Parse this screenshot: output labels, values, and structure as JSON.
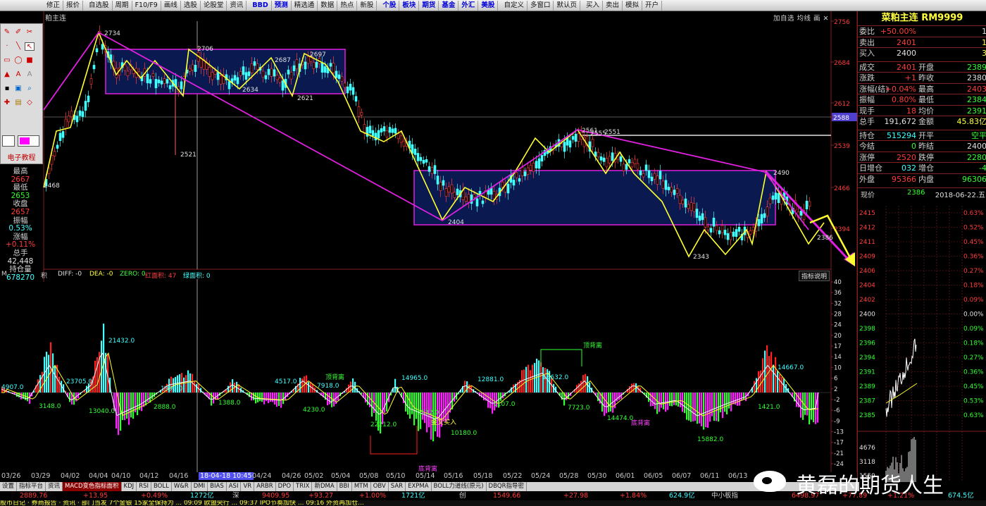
{
  "toolbar": {
    "items": [
      "修正",
      "报价",
      "自选股",
      "周期",
      "F10/F9",
      "画线",
      "选股",
      "论股堂",
      "资讯",
      "BBD",
      "预测",
      "精选通",
      "数据",
      "热点",
      "新股",
      "个股",
      "板块",
      "期货",
      "基金",
      "外汇",
      "美股",
      "自定义",
      "多窗口",
      "默认页",
      "买入",
      "卖出",
      "模拟",
      "开户"
    ],
    "blue_items": [
      "BBD",
      "预测",
      "个股",
      "板块",
      "期货",
      "基金",
      "外汇",
      "美股"
    ]
  },
  "chart": {
    "title": "粕主连",
    "right_buttons": "加自选 均线 画 ✕",
    "price_axis": [
      "2756",
      "2684",
      "2612",
      "2588",
      "2539",
      "2466",
      "2394"
    ],
    "current_price_label": "2588",
    "annotations": [
      "2734",
      "2706",
      "2697",
      "2687",
      "2634",
      "2621",
      "2521",
      "2468",
      "2561",
      "2555",
      "2551",
      "2490",
      "2404",
      "2343",
      "2386"
    ]
  },
  "toolbox": {
    "label": "电子教程"
  },
  "left_info": {
    "rows": [
      {
        "label": "最高",
        "value": "2667",
        "color": "red"
      },
      {
        "label": "最低",
        "value": "2653",
        "color": "grn"
      },
      {
        "label": "收盘",
        "value": "2657",
        "color": "red"
      },
      {
        "label": "振幅",
        "value": "0.53%",
        "color": "cyan"
      },
      {
        "label": "涨幅",
        "value": "+0.11%",
        "color": "red"
      },
      {
        "label": "总手",
        "value": "42,448",
        "color": "wht"
      },
      {
        "label": "持仓量",
        "value": "678270",
        "color": "cyan"
      }
    ]
  },
  "indicator": {
    "header": {
      "name": "M",
      "sub": "积",
      "diff": "DIFF: -0",
      "dea": "DEA: -0",
      "zero": "ZERO: 0",
      "red_area": "红面积: 47",
      "green_area": "绿面积: 0"
    },
    "explain_button": "指标说明",
    "axis": [
      "40",
      "36",
      "32",
      "28",
      "24",
      "20",
      "17",
      "14",
      "10",
      "6",
      "2",
      "-2",
      "-6",
      "-9",
      "-13",
      "-17",
      "-21",
      "-24"
    ],
    "labels": [
      {
        "t": "4907.0",
        "c": "#40ffff"
      },
      {
        "t": "23705.0",
        "c": "#40ffff"
      },
      {
        "t": "3148.0",
        "c": "#32ff32"
      },
      {
        "t": "13040.0",
        "c": "#32ff32"
      },
      {
        "t": "21432.0",
        "c": "#40ffff"
      },
      {
        "t": "1993.0",
        "c": "#40ffff"
      },
      {
        "t": "2888.0",
        "c": "#32ff32"
      },
      {
        "t": "1388.0",
        "c": "#32ff32"
      },
      {
        "t": "4517.0",
        "c": "#40ffff"
      },
      {
        "t": "顶背离",
        "c": "#32ff32"
      },
      {
        "t": "7918.0",
        "c": "#40ffff"
      },
      {
        "t": "4230.0",
        "c": "#32ff32"
      },
      {
        "t": "14965.0",
        "c": "#40ffff"
      },
      {
        "t": "22212.0",
        "c": "#32ff32"
      },
      {
        "t": "5532.0",
        "c": "#32ff32"
      },
      {
        "t": "金叉买入",
        "c": "#ffff40"
      },
      {
        "t": "10180.0",
        "c": "#32ff32"
      },
      {
        "t": "12881.0",
        "c": "#40ffff"
      },
      {
        "t": "1107.0",
        "c": "#32ff32"
      },
      {
        "t": "13632.0",
        "c": "#40ffff"
      },
      {
        "t": "顶背离",
        "c": "#32ff32"
      },
      {
        "t": "7723.0",
        "c": "#32ff32"
      },
      {
        "t": "14474.0",
        "c": "#32ff32"
      },
      {
        "t": "底背离",
        "c": "#ff40ff"
      },
      {
        "t": "15882.0",
        "c": "#32ff32"
      },
      {
        "t": "1421.0",
        "c": "#32ff32"
      },
      {
        "t": "14667.0",
        "c": "#40ffff"
      },
      {
        "t": "底背离",
        "c": "#ff40ff"
      }
    ]
  },
  "xaxis": {
    "labels": [
      "03/26",
      "03/29",
      "04/02",
      "04/04",
      "04/10",
      "04/12",
      "04/16",
      "18-04-18 10:45",
      "04/24",
      "04/26",
      "05/02",
      "05/04",
      "05/08",
      "05/10",
      "05/14",
      "05/16",
      "05/18",
      "05/22",
      "05/24",
      "05/28",
      "05/30",
      "06/01",
      "06/05",
      "06/07",
      "06/11",
      "06/13"
    ],
    "highlight": "18-04-18 10:45"
  },
  "tabs": {
    "items": [
      "设置",
      "指标平台",
      "资讯",
      "MACD变色指标面积",
      "KDJ",
      "RSI",
      "BOLL",
      "W&R",
      "DMI",
      "BIAS",
      "ASI",
      "VR",
      "ARBR",
      "DPO",
      "TRIX",
      "新DMA",
      "BBI",
      "MTM",
      "OBV",
      "SAR",
      "EXPMA",
      "BOLL力道线(原元)",
      "DBQR指导密"
    ],
    "active": "MACD变色指标面积"
  },
  "ticker": {
    "items": [
      {
        "t": "2889.76",
        "c": "#ff3c3c"
      },
      {
        "t": "+13.95",
        "c": "#ff3c3c"
      },
      {
        "t": "+0.49%",
        "c": "#ff3c3c"
      },
      {
        "t": "1272亿",
        "c": "#40ffff"
      },
      {
        "t": "深",
        "c": "#d0d0d0"
      },
      {
        "t": "9409.95",
        "c": "#ff3c3c"
      },
      {
        "t": "+93.27",
        "c": "#ff3c3c"
      },
      {
        "t": "+1.00%",
        "c": "#ff3c3c"
      },
      {
        "t": "1721亿",
        "c": "#40ffff"
      },
      {
        "t": "创",
        "c": "#d0d0d0"
      },
      {
        "t": "1549.66",
        "c": "#ff3c3c"
      },
      {
        "t": "+27.98",
        "c": "#ff3c3c"
      },
      {
        "t": "+1.84%",
        "c": "#ff3c3c"
      },
      {
        "t": "624.9亿",
        "c": "#40ffff"
      },
      {
        "t": "中小板指",
        "c": "#d0d0d0"
      },
      {
        "t": "6498.97",
        "c": "#ff3c3c"
      },
      {
        "t": "+77.89",
        "c": "#ff3c3c"
      },
      {
        "t": "+1.21%",
        "c": "#ff3c3c"
      },
      {
        "t": "674.5亿",
        "c": "#40ffff"
      }
    ]
  },
  "news": "股市日记 · 券商报告 · 资讯 · 部门当发 7个金银 15家全保持为 ... 09:09 欧盟央行 ... 09:37 IPO节奏加快 ... 09:16 外资再加仓...",
  "right": {
    "title": "菜粕主连 RM9999",
    "rows": [
      {
        "l1": "委比",
        "v1": "+50.00%",
        "c1": "red",
        "l2": "",
        "v2": "1",
        "c2": "wht"
      },
      {
        "l1": "卖出",
        "v1": "2401",
        "c1": "red",
        "l2": "",
        "v2": "1",
        "c2": "yel"
      },
      {
        "l1": "买入",
        "v1": "2400",
        "c1": "wht",
        "l2": "",
        "v2": "3",
        "c2": "yel"
      },
      {
        "l1": "成交",
        "v1": "2401",
        "c1": "red",
        "l2": "开盘",
        "v2": "2389",
        "c2": "grn"
      },
      {
        "l1": "涨跌",
        "v1": "+1",
        "c1": "red",
        "l2": "昨收",
        "v2": "2380",
        "c2": "wht"
      },
      {
        "l1": "涨幅(结)",
        "v1": "+0.04%",
        "c1": "red",
        "l2": "最高",
        "v2": "2403",
        "c2": "red"
      },
      {
        "l1": "振幅",
        "v1": "0.80%",
        "c1": "red",
        "l2": "最低",
        "v2": "2384",
        "c2": "grn"
      },
      {
        "l1": "现手",
        "v1": "18",
        "c1": "red",
        "l2": "均价",
        "v2": "2391",
        "c2": "grn"
      },
      {
        "l1": "总手",
        "v1": "191,672",
        "c1": "wht",
        "l2": "金额",
        "v2": "45.83亿",
        "c2": "yel"
      },
      {
        "l1": "持仓",
        "v1": "515294",
        "c1": "cyan",
        "l2": "开平",
        "v2": "空平",
        "c2": "grn"
      },
      {
        "l1": "今结",
        "v1": "0",
        "c1": "grn",
        "l2": "昨结",
        "v2": "2400",
        "c2": "wht"
      },
      {
        "l1": "涨停",
        "v1": "2520",
        "c1": "red",
        "l2": "跌停",
        "v2": "2280",
        "c2": "grn"
      },
      {
        "l1": "日增仓",
        "v1": "032",
        "c1": "cyan",
        "l2": "增仓",
        "v2": "-4",
        "c2": "grn"
      },
      {
        "l1": "外盘",
        "v1": "95366",
        "c1": "red",
        "l2": "内盘",
        "v2": "96306",
        "c2": "grn"
      }
    ],
    "now_label": "现价",
    "now_value": "2386",
    "date": "2018-06-22.五",
    "prices": [
      "2415",
      "2412",
      "2411",
      "2409",
      "2406",
      "2404",
      "2402",
      "2400",
      "2398",
      "2396",
      "2394",
      "2391",
      "2389",
      "2387",
      "2385"
    ],
    "pcts": [
      "0.63%",
      "0.52%",
      "0.45%",
      "0.36%",
      "0.27%",
      "0.18%",
      "0.09%",
      "0.00%",
      "0.09%",
      "0.18%",
      "0.27%",
      "0.36%",
      "0.45%",
      "0.53%",
      "0.63%"
    ],
    "volumes": [
      "4676",
      "3118",
      "1559"
    ]
  },
  "watermark": "黄磊的期货人生"
}
